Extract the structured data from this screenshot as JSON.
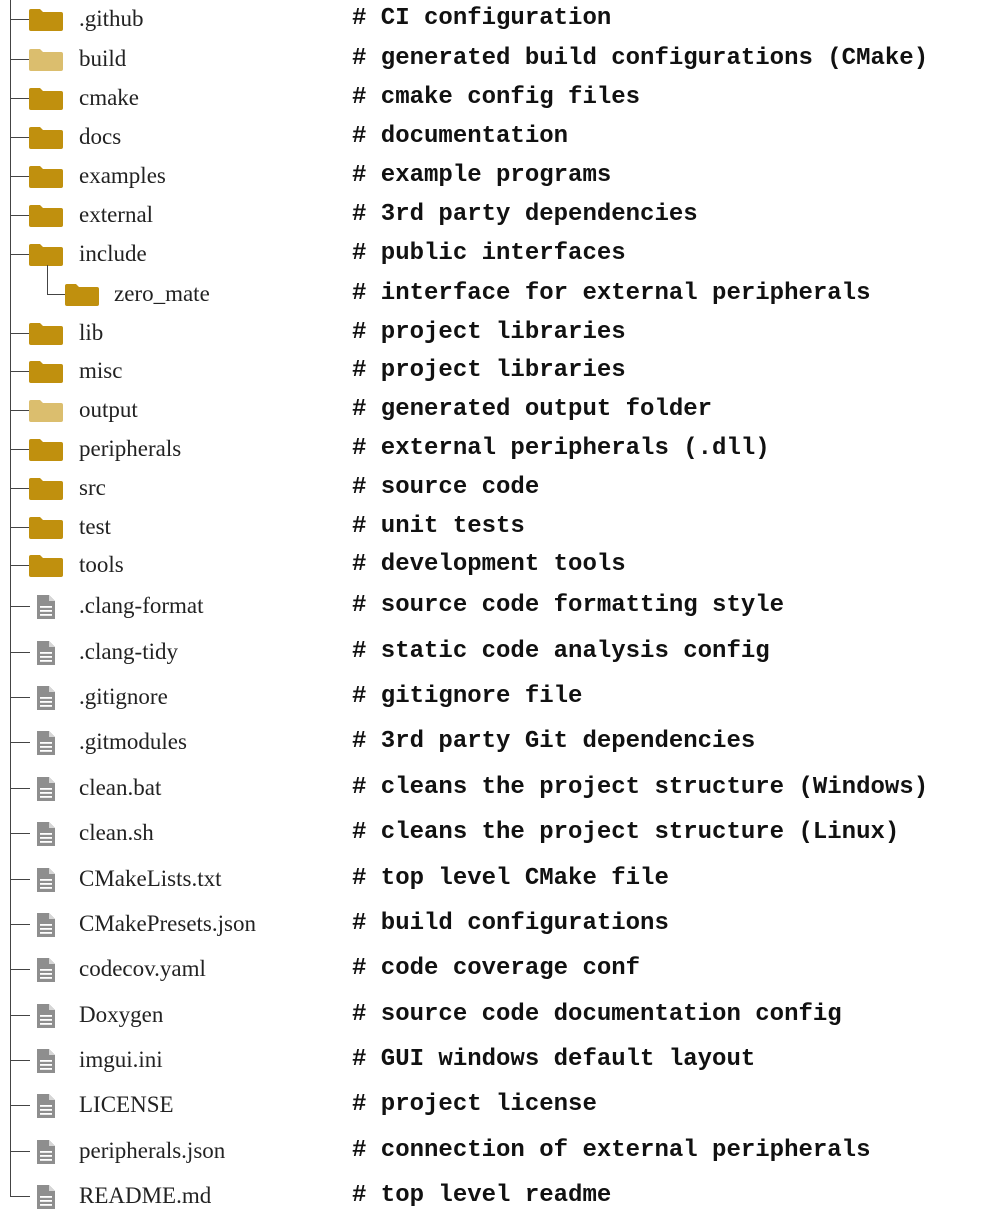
{
  "colors": {
    "folder": "#C0900E",
    "folder_generated": "#DBBE6E",
    "file": "#8E8E8E",
    "line": "#444444"
  },
  "entries": [
    {
      "name": ".github",
      "comment": "# CI configuration",
      "type": "folder"
    },
    {
      "name": "build",
      "comment": "# generated build configurations (CMake)",
      "type": "folder-generated"
    },
    {
      "name": "cmake",
      "comment": "# cmake config files",
      "type": "folder"
    },
    {
      "name": "docs",
      "comment": "# documentation",
      "type": "folder"
    },
    {
      "name": "examples",
      "comment": "# example programs",
      "type": "folder"
    },
    {
      "name": "external",
      "comment": "# 3rd party dependencies",
      "type": "folder"
    },
    {
      "name": "include",
      "comment": "# public interfaces",
      "type": "folder"
    },
    {
      "name": "zero_mate",
      "comment": "# interface for external peripherals",
      "type": "folder",
      "child": true
    },
    {
      "name": "lib",
      "comment": "# project libraries",
      "type": "folder"
    },
    {
      "name": "misc",
      "comment": "# project libraries",
      "type": "folder"
    },
    {
      "name": "output",
      "comment": "# generated output folder",
      "type": "folder-generated"
    },
    {
      "name": "peripherals",
      "comment": "# external peripherals (.dll)",
      "type": "folder"
    },
    {
      "name": "src",
      "comment": "# source code",
      "type": "folder"
    },
    {
      "name": "test",
      "comment": "# unit tests",
      "type": "folder"
    },
    {
      "name": "tools",
      "comment": "# development tools",
      "type": "folder"
    },
    {
      "name": ".clang-format",
      "comment": "# source code formatting style",
      "type": "file"
    },
    {
      "name": ".clang-tidy",
      "comment": "# static code analysis config",
      "type": "file"
    },
    {
      "name": ".gitignore",
      "comment": "# gitignore file",
      "type": "file"
    },
    {
      "name": ".gitmodules",
      "comment": "# 3rd party Git dependencies",
      "type": "file"
    },
    {
      "name": "clean.bat",
      "comment": "# cleans the project structure (Windows)",
      "type": "file"
    },
    {
      "name": "clean.sh",
      "comment": "# cleans the project structure (Linux)",
      "type": "file"
    },
    {
      "name": "CMakeLists.txt",
      "comment": "# top level CMake file",
      "type": "file"
    },
    {
      "name": "CMakePresets.json",
      "comment": "# build configurations",
      "type": "file"
    },
    {
      "name": "codecov.yaml",
      "comment": "# code coverage conf",
      "type": "file"
    },
    {
      "name": "Doxygen",
      "comment": "# source code documentation config",
      "type": "file"
    },
    {
      "name": "imgui.ini",
      "comment": "# GUI windows default layout",
      "type": "file"
    },
    {
      "name": "LICENSE",
      "comment": "# project license",
      "type": "file"
    },
    {
      "name": "peripherals.json",
      "comment": "# connection of external peripherals",
      "type": "file"
    },
    {
      "name": "README.md",
      "comment": "# top level readme",
      "type": "file"
    }
  ]
}
